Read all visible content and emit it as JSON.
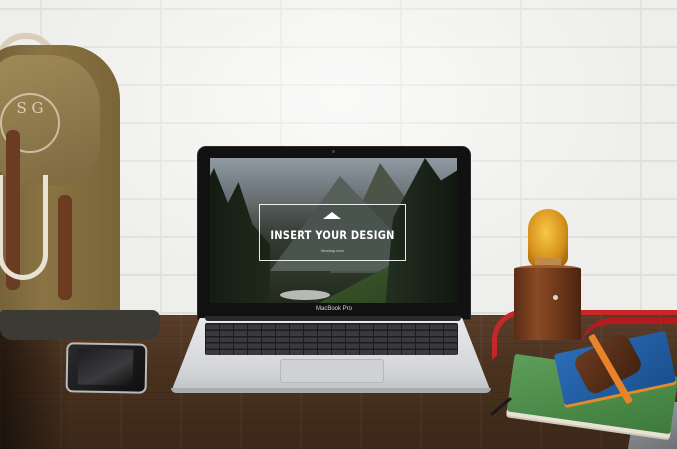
{
  "screen": {
    "headline": "INSERT YOUR DESIGN",
    "subtext": "Mockup.com"
  },
  "laptop": {
    "brand_label": "MacBook Pro"
  },
  "backpack": {
    "logo_text": "S G"
  }
}
